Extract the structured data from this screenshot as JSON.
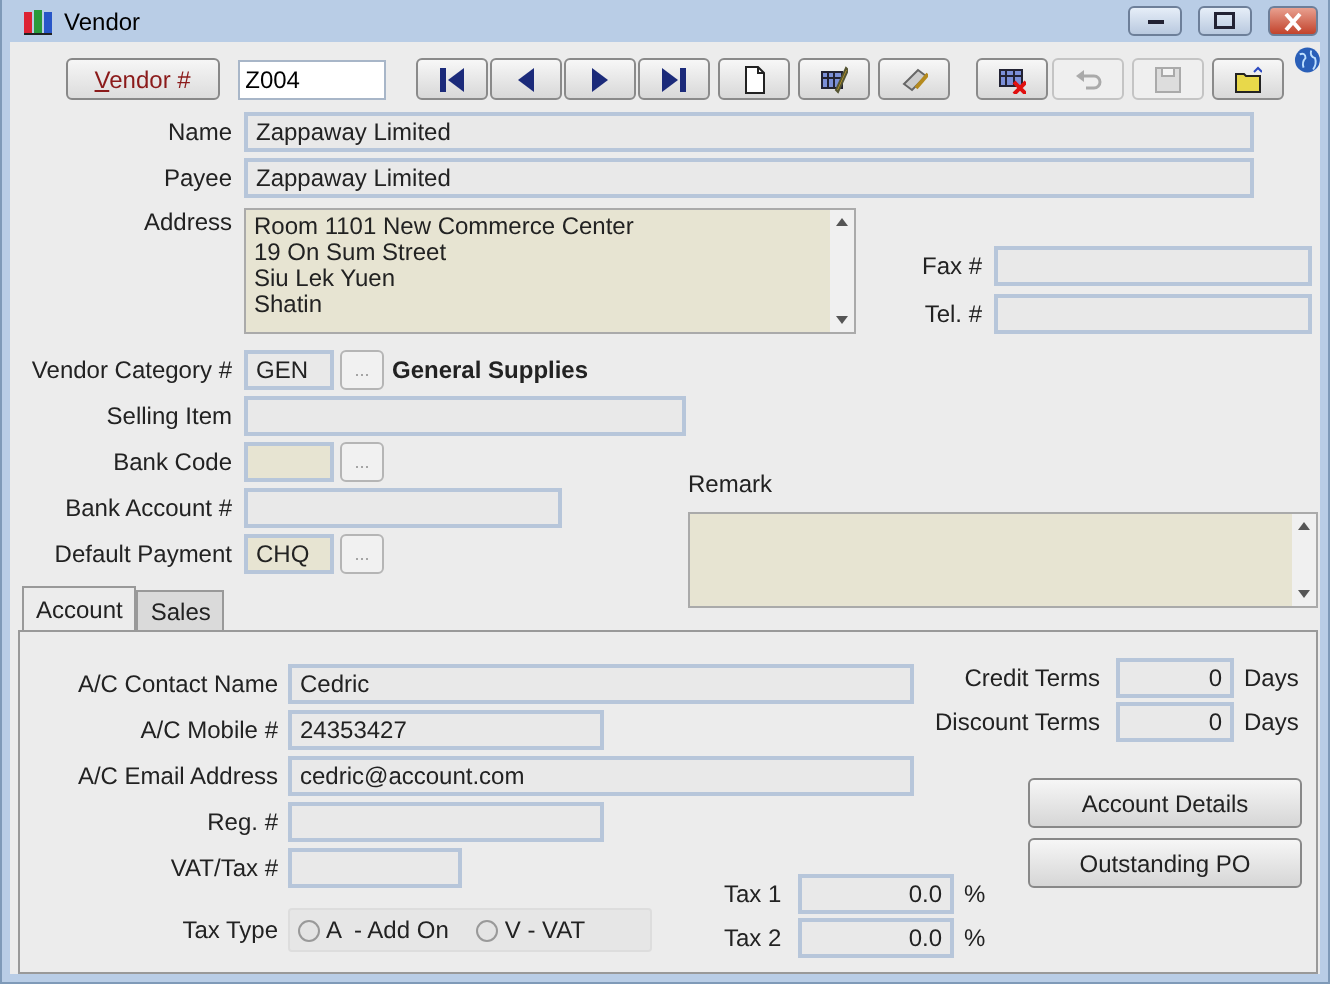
{
  "window": {
    "title": "Vendor"
  },
  "toolbar": {
    "vendor_button": "Vendor #",
    "vendor_no": "Z004",
    "button_groups": [
      [
        {
          "kind": "first",
          "disabled": false
        },
        {
          "kind": "prev",
          "disabled": false
        },
        {
          "kind": "next",
          "disabled": false
        },
        {
          "kind": "last",
          "disabled": false
        }
      ],
      [
        {
          "kind": "new",
          "disabled": false
        },
        {
          "kind": "edit",
          "disabled": false
        },
        {
          "kind": "note",
          "disabled": false
        }
      ],
      [
        {
          "kind": "delete",
          "disabled": false
        }
      ],
      [
        {
          "kind": "undo",
          "disabled": true
        },
        {
          "kind": "save",
          "disabled": true
        },
        {
          "kind": "open",
          "disabled": false
        }
      ]
    ]
  },
  "name": {
    "label": "Name",
    "value": "Zappaway Limited"
  },
  "payee": {
    "label": "Payee",
    "value": "Zappaway Limited"
  },
  "address": {
    "label": "Address",
    "lines": [
      "Room 1101 New Commerce Center",
      "19 On Sum Street",
      "Siu Lek Yuen",
      "Shatin"
    ]
  },
  "fax": {
    "label": "Fax #"
  },
  "tel": {
    "label": "Tel. #"
  },
  "vendor_category": {
    "label": "Vendor Category #",
    "value": "GEN",
    "highlighted": false,
    "button": "...",
    "description": "General Supplies"
  },
  "selling_item": {
    "label": "Selling Item"
  },
  "bank_code": {
    "label": "Bank Code",
    "highlighted": true,
    "button": "..."
  },
  "bank_account": {
    "label": "Bank Account #"
  },
  "default_payment": {
    "label": "Default Payment",
    "value": "CHQ",
    "highlighted": true,
    "button": "..."
  },
  "remark": {
    "label": "Remark"
  },
  "tabs": [
    {
      "label": "Account",
      "selected": true
    },
    {
      "label": "Sales",
      "selected": false
    }
  ],
  "account": {
    "contact_name": {
      "label": "A/C Contact Name",
      "value": "Cedric"
    },
    "mobile": {
      "label": "A/C Mobile #",
      "value": "24353427"
    },
    "email": {
      "label": "A/C Email Address",
      "value": "cedric@account.com"
    },
    "reg": {
      "label": "Reg. #"
    },
    "vat": {
      "label": "VAT/Tax #"
    },
    "tax_type": {
      "label": "Tax Type",
      "options": [
        {
          "label": "A  - Add On",
          "selected": false
        },
        {
          "label": "V - VAT",
          "selected": false
        }
      ]
    },
    "tax1": {
      "label": "Tax 1",
      "value": "0.0",
      "unit": "%"
    },
    "tax2": {
      "label": "Tax 2",
      "value": "0.0",
      "unit": "%"
    },
    "credit_terms": {
      "label": "Credit Terms",
      "value": "0",
      "unit": "Days"
    },
    "discount_terms": {
      "label": "Discount Terms",
      "value": "0",
      "unit": "Days"
    },
    "buttons": [
      "Account Details",
      "Outstanding PO"
    ]
  }
}
